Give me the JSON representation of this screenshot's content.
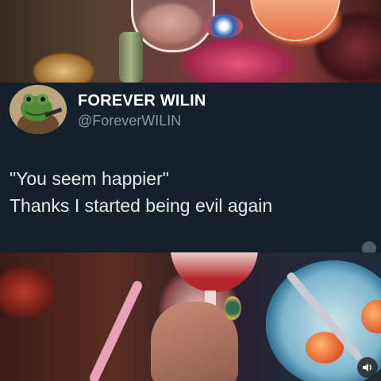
{
  "post": {
    "display_name": "FOREVER WILIN",
    "handle": "@ForeverWILIN",
    "lines": [
      "\"You seem happier\"",
      "Thanks I started being evil again"
    ]
  },
  "media": {
    "top_image": "painting-top",
    "bottom_image": "painting-bottom",
    "sound_icon": "speaker-icon"
  },
  "colors": {
    "card_background": "#16202a",
    "name": "#ffffff",
    "handle": "#8b98a5",
    "body_text": "#e7e9ea"
  }
}
